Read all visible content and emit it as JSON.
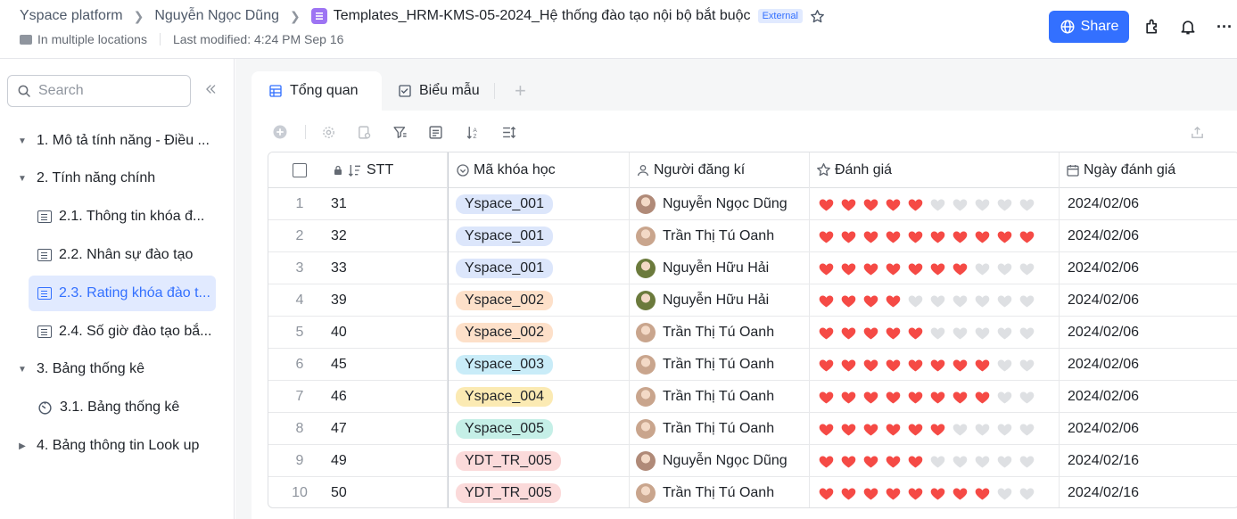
{
  "header": {
    "breadcrumbs": [
      "Yspace platform",
      "Nguyễn Ngọc Dũng"
    ],
    "doc_title": "Templates_HRM-KMS-05-2024_Hệ thống đào tạo nội bộ bắt buộc",
    "external_badge": "External",
    "location": "In multiple locations",
    "last_modified": "Last modified: 4:24 PM Sep 16",
    "share_label": "Share",
    "more_label": "···"
  },
  "sidebar": {
    "search_placeholder": "Search",
    "items": [
      {
        "label": "1. Mô tả tính năng - Điều ...",
        "type": "section",
        "expanded": true
      },
      {
        "label": "2. Tính năng chính",
        "type": "section",
        "expanded": true
      },
      {
        "label": "2.1. Thông tin khóa đ...",
        "type": "table"
      },
      {
        "label": "2.2. Nhân sự đào tạo",
        "type": "table"
      },
      {
        "label": "2.3. Rating khóa đào t...",
        "type": "table",
        "active": true
      },
      {
        "label": "2.4. Số giờ đào tạo bắ...",
        "type": "table"
      },
      {
        "label": "3. Bảng thống kê",
        "type": "section",
        "expanded": true
      },
      {
        "label": "3.1. Bảng thống kê",
        "type": "dashboard"
      },
      {
        "label": "4. Bảng thông tin Look up",
        "type": "section",
        "expanded": false
      }
    ]
  },
  "tabs": [
    {
      "label": "Tổng quan",
      "active": true
    },
    {
      "label": "Biểu mẫu",
      "active": false
    }
  ],
  "table": {
    "columns": [
      "STT",
      "Mã khóa học",
      "Người đăng kí",
      "Đánh giá",
      "Ngày đánh giá"
    ],
    "rows": [
      {
        "idx": "1",
        "stt": "31",
        "code": "Yspace_001",
        "chip": "#dce6fb",
        "person": "Nguyễn Ngọc Dũng",
        "avatar": "#b08a78",
        "rating": 5,
        "date": "2024/02/06"
      },
      {
        "idx": "2",
        "stt": "32",
        "code": "Yspace_001",
        "chip": "#dce6fb",
        "person": "Trần Thị Tú Oanh",
        "avatar": "#c9a58d",
        "rating": 10,
        "date": "2024/02/06"
      },
      {
        "idx": "3",
        "stt": "33",
        "code": "Yspace_001",
        "chip": "#dce6fb",
        "person": "Nguyễn Hữu Hải",
        "avatar": "#6b7a3c",
        "rating": 7,
        "date": "2024/02/06"
      },
      {
        "idx": "4",
        "stt": "39",
        "code": "Yspace_002",
        "chip": "#fde0c9",
        "person": "Nguyễn Hữu Hải",
        "avatar": "#6b7a3c",
        "rating": 4,
        "date": "2024/02/06"
      },
      {
        "idx": "5",
        "stt": "40",
        "code": "Yspace_002",
        "chip": "#fde0c9",
        "person": "Trần Thị Tú Oanh",
        "avatar": "#c9a58d",
        "rating": 5,
        "date": "2024/02/06"
      },
      {
        "idx": "6",
        "stt": "45",
        "code": "Yspace_003",
        "chip": "#c9ecf8",
        "person": "Trần Thị Tú Oanh",
        "avatar": "#c9a58d",
        "rating": 8,
        "date": "2024/02/06"
      },
      {
        "idx": "7",
        "stt": "46",
        "code": "Yspace_004",
        "chip": "#fbeab3",
        "person": "Trần Thị Tú Oanh",
        "avatar": "#c9a58d",
        "rating": 8,
        "date": "2024/02/06"
      },
      {
        "idx": "8",
        "stt": "47",
        "code": "Yspace_005",
        "chip": "#c5efe7",
        "person": "Trần Thị Tú Oanh",
        "avatar": "#c9a58d",
        "rating": 6,
        "date": "2024/02/06"
      },
      {
        "idx": "9",
        "stt": "49",
        "code": "YDT_TR_005",
        "chip": "#fbdada",
        "person": "Nguyễn Ngọc Dũng",
        "avatar": "#b08a78",
        "rating": 5,
        "date": "2024/02/16"
      },
      {
        "idx": "10",
        "stt": "50",
        "code": "YDT_TR_005",
        "chip": "#fbdada",
        "person": "Trần Thị Tú Oanh",
        "avatar": "#c9a58d",
        "rating": 8,
        "date": "2024/02/16"
      }
    ],
    "max_rating": 10
  },
  "colors": {
    "accent": "#3370ff",
    "heart_on": "#f54a45",
    "heart_off": "#dee0e3"
  }
}
